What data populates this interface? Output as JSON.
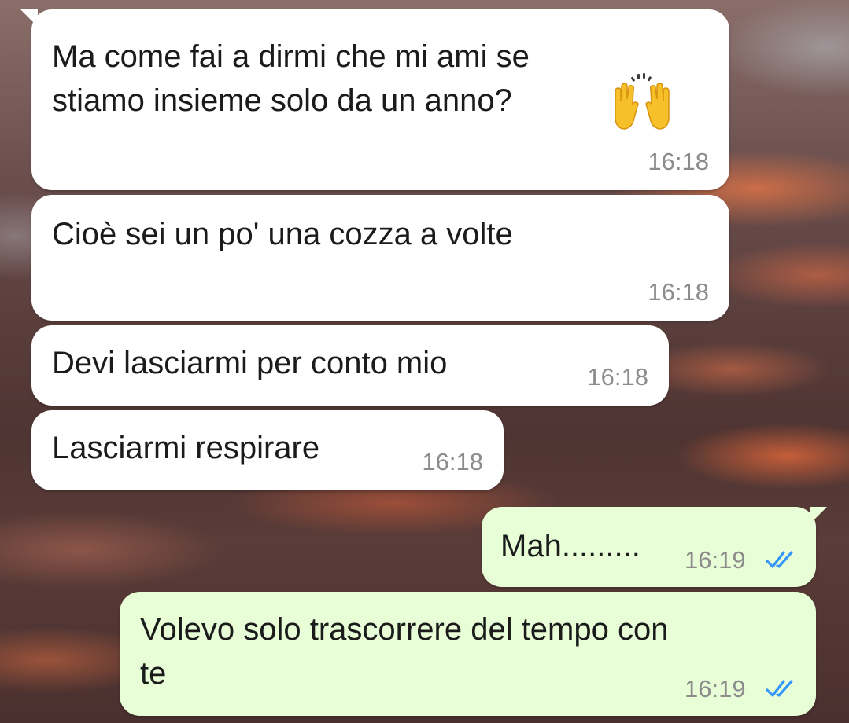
{
  "accent": {
    "incoming_bubble": "#ffffff",
    "outgoing_bubble": "#e7fed7",
    "read_ticks": "#3497f9",
    "timestamp": "#8c8c8c"
  },
  "messages": [
    {
      "direction": "incoming",
      "text": "Ma come fai a dirmi che mi ami se\nstiamo insieme solo da un anno?",
      "emoji": "raising-hands-emoji",
      "time": "16:18"
    },
    {
      "direction": "incoming",
      "text": "Cioè sei un po' una cozza a volte",
      "time": "16:18"
    },
    {
      "direction": "incoming",
      "text": "Devi lasciarmi per conto mio",
      "time": "16:18"
    },
    {
      "direction": "incoming",
      "text": "Lasciarmi respirare",
      "time": "16:18"
    },
    {
      "direction": "outgoing",
      "text": "Mah.........",
      "time": "16:19",
      "status": "read-double-check-icon"
    },
    {
      "direction": "outgoing",
      "text": "Volevo solo trascorrere del tempo con\nte",
      "time": "16:19",
      "status": "read-double-check-icon"
    }
  ]
}
